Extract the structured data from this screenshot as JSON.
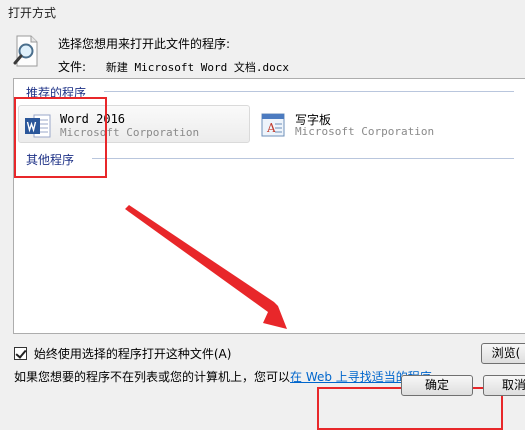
{
  "window": {
    "title": "打开方式"
  },
  "header": {
    "instruction": "选择您想用来打开此文件的程序:",
    "file_label": "文件:",
    "file_name": "新建 Microsoft Word 文档.docx"
  },
  "groups": {
    "recommended": "推荐的程序",
    "other": "其他程序"
  },
  "programs": [
    {
      "name": "Word 2016",
      "company": "Microsoft Corporation",
      "selected": true,
      "icon": "word-icon"
    },
    {
      "name": "写字板",
      "company": "Microsoft Corporation",
      "selected": false,
      "icon": "wordpad-icon"
    }
  ],
  "options": {
    "always_use": "始终使用选择的程序打开这种文件(A)",
    "always_use_checked": true
  },
  "buttons": {
    "browse": "浏览(",
    "ok": "确定",
    "cancel": "取消"
  },
  "hint": {
    "prefix": "如果您想要的程序不在列表或您的计算机上，您可以",
    "link": "在 Web 上寻找适当的程序",
    "suffix": "。"
  },
  "colors": {
    "annotation": "#e8272a",
    "group_header": "#1e3287",
    "link": "#0066cc"
  }
}
